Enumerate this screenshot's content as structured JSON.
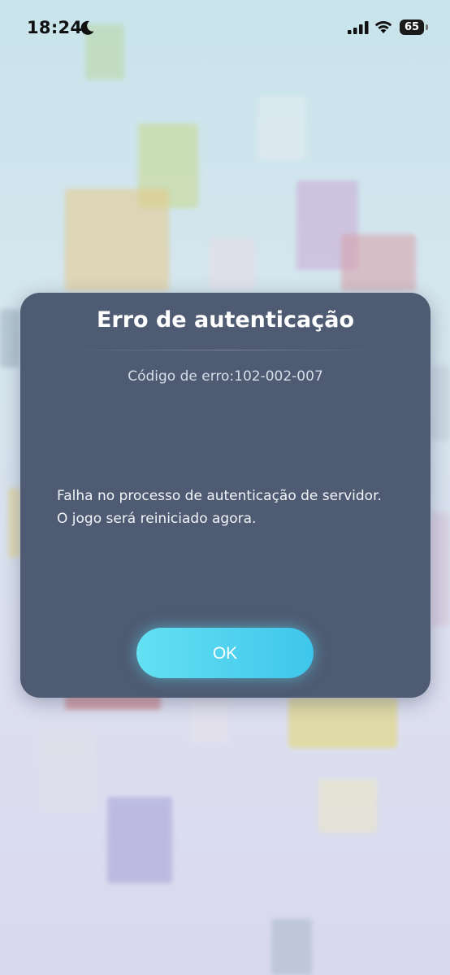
{
  "status_bar": {
    "time": "18:24",
    "battery": "65",
    "icons": [
      "moon-icon",
      "signal-icon",
      "wifi-icon",
      "battery-icon"
    ]
  },
  "dialog": {
    "title": "Erro de autenticação",
    "error_code": "Código de erro:102-002-007",
    "message": "Falha no processo de autenticação de servidor.\nO jogo será reiniciado agora.",
    "ok_label": "OK"
  },
  "colors": {
    "dialog_bg": "#4e5b72",
    "button": "#4fd2ee",
    "background": "#d6e6ee"
  }
}
